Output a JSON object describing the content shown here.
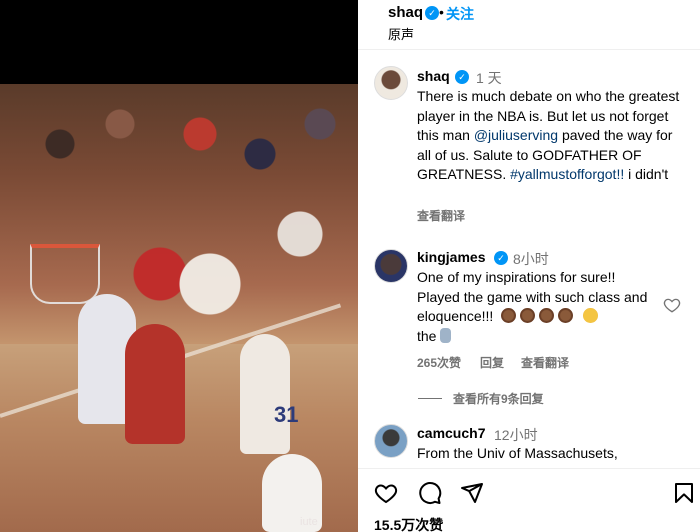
{
  "post": {
    "username": "shaq",
    "follow_label": "关注",
    "dot": "•",
    "subtitle": "原声",
    "likes": "15.5万次赞"
  },
  "media": {
    "jersey_number": "31",
    "watermark": "iute"
  },
  "comments": [
    {
      "username": "shaq",
      "time": "1 天",
      "text_part1": "There is much debate on who the greatest player in the NBA is. But let us not forget this man ",
      "mention": "@juliuserving",
      "text_part2": " paved the way for all of us. Salute to GODFATHER OF GREATNESS. ",
      "hashtag": "#yallmustofforgot!!",
      "text_part3": " i didn't",
      "translate": "查看翻译"
    },
    {
      "username": "kingjames",
      "time": "8小时",
      "text": "One of my inspirations for sure!! Played the game with such class and eloquence!!!",
      "text_tail": "the",
      "likes": "265次赞",
      "reply": "回复",
      "translate": "查看翻译"
    },
    {
      "username": "camcuch7",
      "time": "12小时",
      "text": "From the Univ of Massachusets,"
    }
  ],
  "view_replies": "查看所有9条回复",
  "colors": {
    "verified": "#0095f6",
    "link": "#00376b",
    "secondary": "#737373"
  },
  "icons": [
    "heart-icon",
    "comment-icon",
    "share-icon",
    "bookmark-icon",
    "verified-icon"
  ]
}
